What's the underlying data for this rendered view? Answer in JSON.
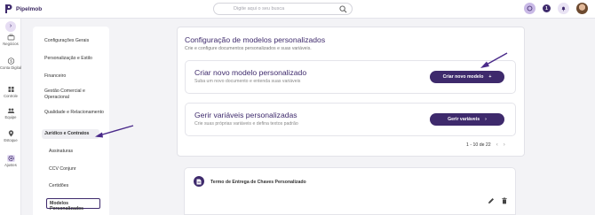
{
  "app": {
    "name": "Pipelmob"
  },
  "search": {
    "placeholder": "Digite aqui o seu busca"
  },
  "topbar": {
    "badge": "1"
  },
  "rail": {
    "items": [
      {
        "label": "Negócios",
        "icon": "briefcase-icon"
      },
      {
        "label": "Conta Digital",
        "icon": "dollar-icon"
      },
      {
        "label": "Controle",
        "icon": "grid-icon"
      },
      {
        "label": "Equipe",
        "icon": "team-icon"
      },
      {
        "label": "Estoque",
        "icon": "pin-icon"
      },
      {
        "label": "Ajustes",
        "icon": "gear-icon"
      }
    ]
  },
  "menu": {
    "items": [
      "Configurações Gerais",
      "Personalização e Estilo",
      "Financeiro",
      "Gestão Comercial e Operacional",
      "Qualidade e Relacionamento",
      "Jurídico e Contratos",
      "Assinaturas",
      "CCV Conjunr",
      "Certidões",
      "Modelos Personalizados"
    ]
  },
  "main": {
    "title": "Configuração de modelos personalizados",
    "subtitle": "Crie e configure documentos personalizados e suas variáveis.",
    "cards": [
      {
        "title": "Criar novo modelo personalizado",
        "subtitle": "Suba um novo documento e entenda suas variáveis",
        "button": "Criar novo modelo",
        "button_icon": "+"
      },
      {
        "title": "Gerir variáveis personalizadas",
        "subtitle": "Crie suas próprias variáveis e defina textos padrão",
        "button": "Gerir variáveis",
        "button_icon": "›"
      }
    ]
  },
  "pager": {
    "label": "1 - 10 de 22",
    "prev": "‹",
    "next": "›"
  },
  "template": {
    "title": "Termo de Entrega de Chaves Personalizado"
  },
  "colors": {
    "accent": "#3e2a6c",
    "annotation": "#4a2a8a"
  }
}
